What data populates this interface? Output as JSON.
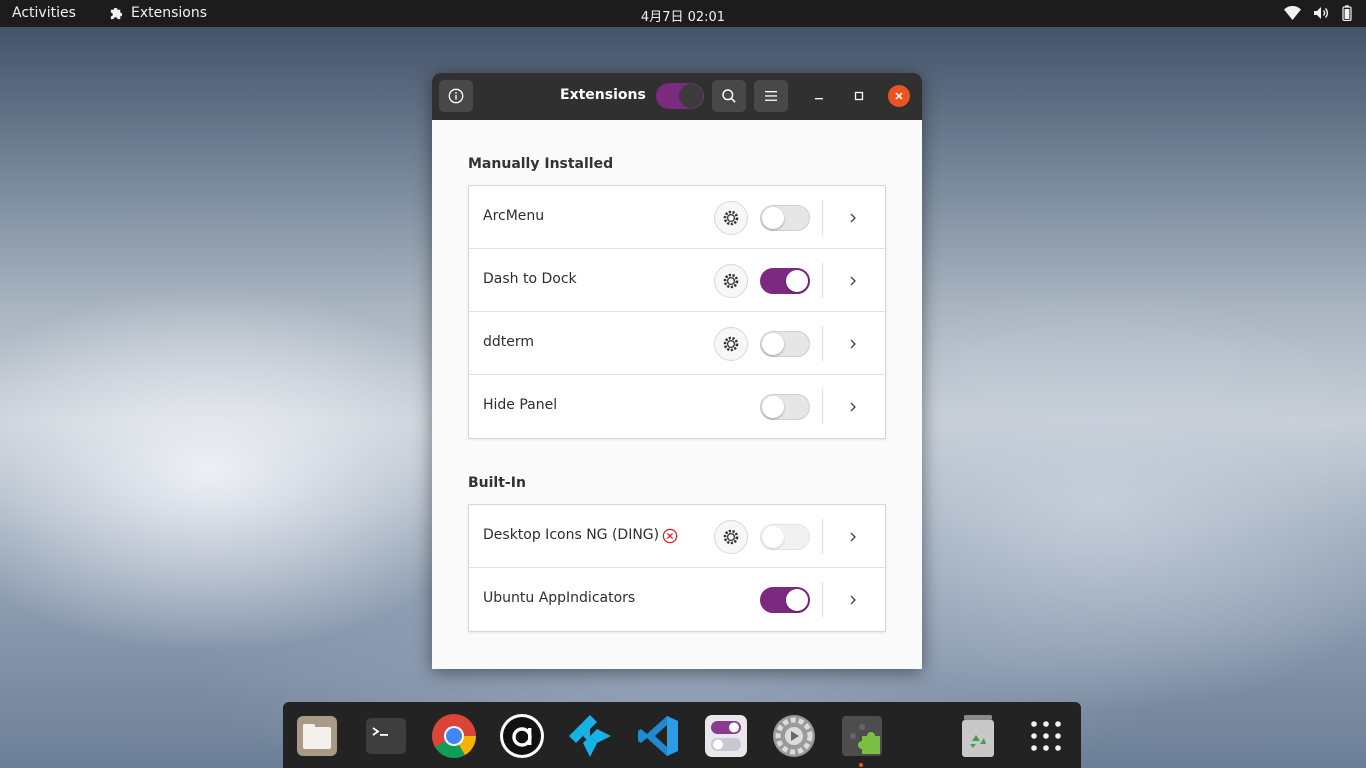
{
  "topbar": {
    "activities": "Activities",
    "app_name": "Extensions",
    "clock": "4月7日  02:01"
  },
  "window": {
    "title": "Extensions",
    "master_switch_on": true,
    "sections": [
      {
        "title": "Manually Installed",
        "rows": [
          {
            "name": "ArcMenu",
            "has_settings": true,
            "enabled": false,
            "error": false
          },
          {
            "name": "Dash to Dock",
            "has_settings": true,
            "enabled": true,
            "error": false
          },
          {
            "name": "ddterm",
            "has_settings": true,
            "enabled": false,
            "error": false
          },
          {
            "name": "Hide Panel",
            "has_settings": false,
            "enabled": false,
            "error": false
          }
        ]
      },
      {
        "title": "Built-In",
        "rows": [
          {
            "name": "Desktop Icons NG (DING)",
            "has_settings": true,
            "enabled": false,
            "error": true
          },
          {
            "name": "Ubuntu AppIndicators",
            "has_settings": false,
            "enabled": true,
            "error": false
          }
        ]
      }
    ]
  },
  "dock": {
    "items": [
      "files-icon",
      "terminal-icon",
      "chrome-icon",
      "anki-icon",
      "kodi-icon",
      "vscode-icon",
      "tweaks-icon",
      "settings-icon",
      "extensions-icon",
      "trash-icon",
      "app-grid-icon"
    ]
  },
  "colors": {
    "accent": "#7b2a7f",
    "ubuntu_orange": "#e95420",
    "error_red": "#e01b24"
  }
}
